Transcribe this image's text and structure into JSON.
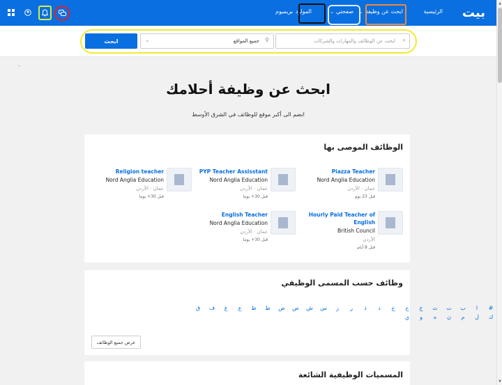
{
  "nav": {
    "logo": "بيت",
    "home": "الرئيسية",
    "job_search": "ابحث عن وظيفة",
    "my_page": "صفحتي",
    "resources": "الموارد",
    "premium": "بريميوم"
  },
  "search": {
    "keywords_placeholder": "ابحث عن الوظائف والمهارات والشركات",
    "location_value": "جميع المواقع",
    "button_label": "ابحث"
  },
  "hero": {
    "title": "ابحث عن وظيفة أحلامك",
    "subtitle": "انضم الى أكبر موقع للوظائف في الشرق الأوسط"
  },
  "recommended": {
    "title": "الوظائف الموصى بها",
    "jobs": [
      {
        "title": "Piazza Teacher",
        "company": "Nord Anglia Education",
        "location": "عمان · الأردن",
        "posted": "قبل 23 يوم"
      },
      {
        "title": "PYP Teacher Assisstant",
        "company": "Nord Anglia Education",
        "location": "عمان · الأردن",
        "posted": "قبل 30+ يوما"
      },
      {
        "title": "Religion teacher",
        "company": "Nord Anglia Education",
        "location": "عمان · الأردن",
        "posted": "قبل 30+ يوما"
      },
      {
        "title": "Hourly Paid Teacher of English",
        "company": "British Council",
        "location": "الأردن",
        "posted": "قبل 8 أيام"
      },
      {
        "title": "English Teacher",
        "company": "Nord Anglia Education",
        "location": "عمان · الأردن",
        "posted": "قبل 30+ يوما"
      }
    ]
  },
  "by_title": {
    "title": "وظائف حسب المسمى الوظيفي",
    "letters": [
      "#",
      "ا",
      "ب",
      "ت",
      "ث",
      "ج",
      "ح",
      "خ",
      "د",
      "ذ",
      "ر",
      "ز",
      "س",
      "ش",
      "ص",
      "ض",
      "ط",
      "ظ",
      "ع",
      "غ",
      "ف",
      "ق",
      "ك",
      "ل",
      "م",
      "ن",
      "ه",
      "و",
      "ي"
    ],
    "view_all": "عرض جميع الوظائف"
  },
  "popular": {
    "title": "المسميات الوظيفية الشائعة"
  }
}
